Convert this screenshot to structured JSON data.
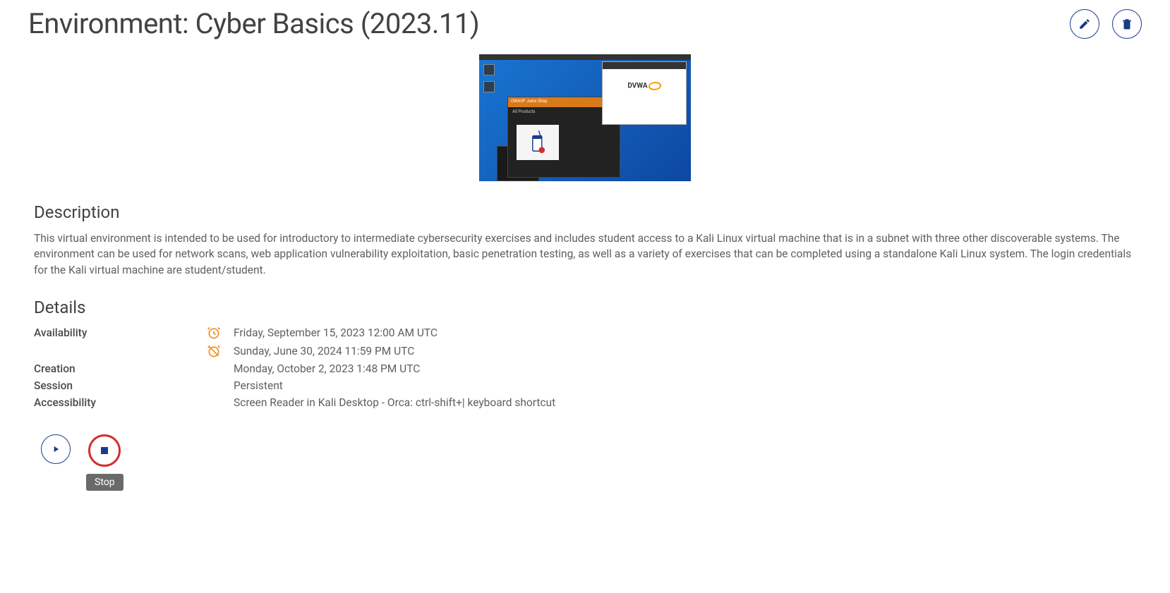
{
  "header": {
    "title": "Environment: Cyber Basics (2023.11)"
  },
  "screenshot": {
    "juice_label": "OWASP Juice Shop",
    "juice_heading": "All Products",
    "dvwa_label": "DVWA"
  },
  "description": {
    "heading": "Description",
    "body": "This virtual environment is intended to be used for introductory to intermediate cybersecurity exercises and includes student access to a Kali Linux virtual machine that is in a subnet with three other discoverable systems. The environment can be used for network scans, web application vulnerability exploitation, basic penetration testing, as well as a variety of exercises that can be completed using a standalone Kali Linux system. The login credentials for the Kali virtual machine are student/student."
  },
  "details": {
    "heading": "Details",
    "availability_label": "Availability",
    "availability_start": "Friday, September 15, 2023 12:00 AM UTC",
    "availability_end": "Sunday, June 30, 2024 11:59 PM UTC",
    "creation_label": "Creation",
    "creation_value": "Monday, October 2, 2023 1:48 PM UTC",
    "session_label": "Session",
    "session_value": "Persistent",
    "accessibility_label": "Accessibility",
    "accessibility_value": "Screen Reader in Kali Desktop - Orca: ctrl-shift+| keyboard shortcut"
  },
  "controls": {
    "stop_tooltip": "Stop"
  }
}
